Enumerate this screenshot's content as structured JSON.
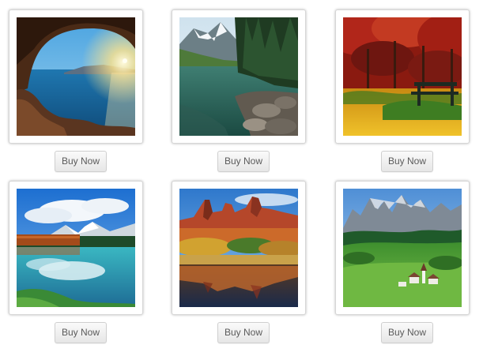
{
  "products": [
    {
      "scene": "sea-cave-sunset",
      "buy_label": "Buy Now"
    },
    {
      "scene": "mountain-lake-rocks",
      "buy_label": "Buy Now"
    },
    {
      "scene": "autumn-forest-bench",
      "buy_label": "Buy Now"
    },
    {
      "scene": "reflective-lake-clouds",
      "buy_label": "Buy Now"
    },
    {
      "scene": "red-rocks-reflection",
      "buy_label": "Buy Now"
    },
    {
      "scene": "alpine-village-meadow",
      "buy_label": "Buy Now"
    }
  ],
  "colors": {
    "button_text": "#5a5a5a",
    "button_border": "#cfcfcf",
    "frame_border": "#d6d6d6",
    "page_background": "#ffffff"
  }
}
